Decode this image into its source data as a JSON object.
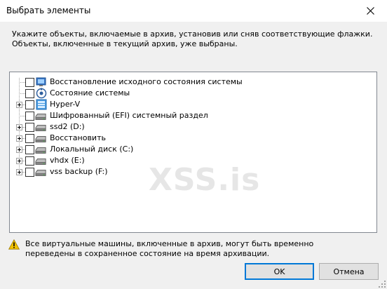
{
  "window": {
    "title": "Выбрать элементы",
    "close_glyph": "✕"
  },
  "instructions": "Укажите объекты, включаемые в архив, установив или сняв соответствующие флажки. Объекты, включенные в текущий архив, уже выбраны.",
  "tree": {
    "items": [
      {
        "label": "Восстановление исходного состояния системы",
        "checked": false,
        "expandable": false,
        "icon": "system-restore-icon"
      },
      {
        "label": "Состояние системы",
        "checked": false,
        "expandable": false,
        "icon": "system-state-icon"
      },
      {
        "label": "Hyper-V",
        "checked": false,
        "expandable": true,
        "icon": "hyperv-icon"
      },
      {
        "label": "Шифрованный (EFI) системный раздел",
        "checked": false,
        "expandable": false,
        "icon": "drive-icon"
      },
      {
        "label": "ssd2 (D:)",
        "checked": false,
        "expandable": true,
        "icon": "drive-icon"
      },
      {
        "label": "Восстановить",
        "checked": false,
        "expandable": true,
        "icon": "drive-icon"
      },
      {
        "label": "Локальный диск (C:)",
        "checked": false,
        "expandable": true,
        "icon": "drive-icon"
      },
      {
        "label": "vhdx (E:)",
        "checked": false,
        "expandable": true,
        "icon": "drive-icon"
      },
      {
        "label": "vss backup (F:)",
        "checked": false,
        "expandable": true,
        "icon": "drive-icon"
      }
    ]
  },
  "watermark": "XSS.is",
  "warning": {
    "icon": "warning-icon",
    "text": "Все виртуальные машины, включенные в архив, могут быть временно переведены в сохраненное состояние на время архивации."
  },
  "buttons": {
    "ok_label": "OK",
    "cancel_label": "Отмена"
  },
  "colors": {
    "accent": "#0078d7",
    "warning": "#f2c200"
  }
}
